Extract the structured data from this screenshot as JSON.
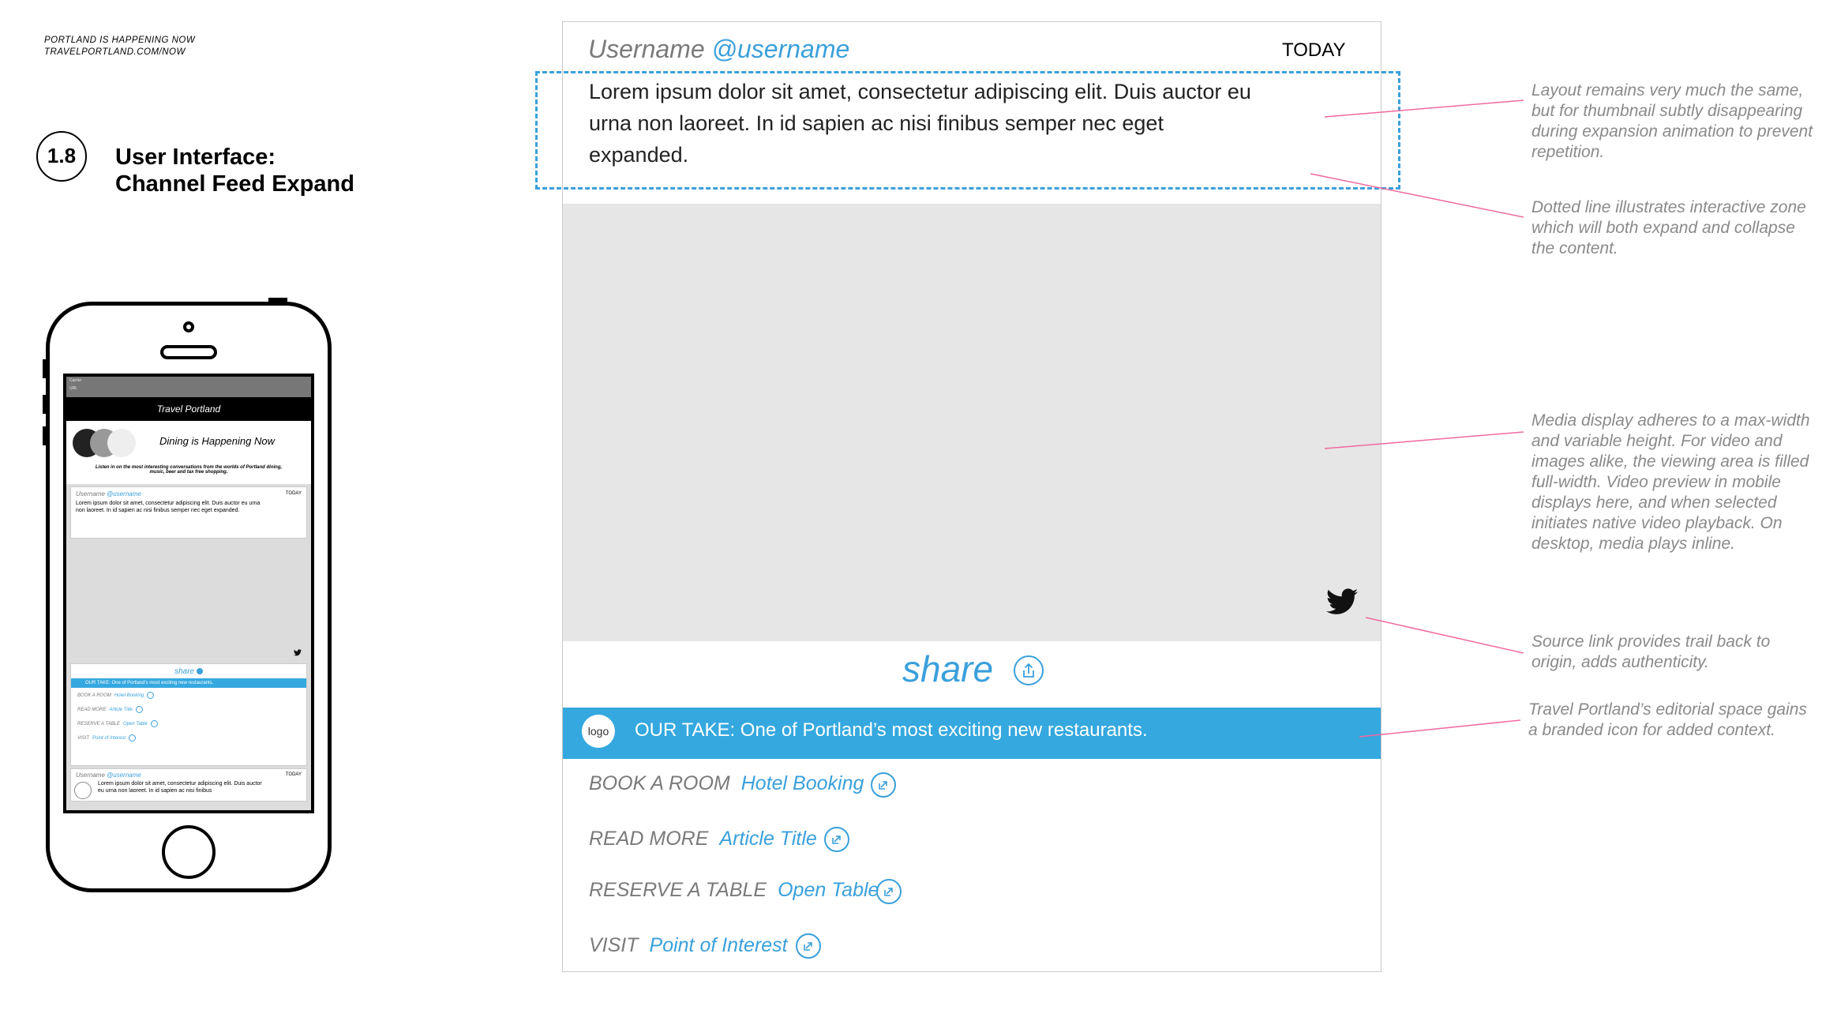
{
  "meta": {
    "line1": "PORTLAND IS HAPPENING NOW",
    "line2": "TRAVELPORTLAND.COM/NOW"
  },
  "section": {
    "number": "1.8",
    "title_line1": "User Interface:",
    "title_line2": "Channel Feed Expand"
  },
  "phone": {
    "status1": "Carrier",
    "status2": "URL",
    "app_title": "Travel Portland",
    "hero_title": "Dining is Happening Now",
    "hero_desc": "Listen in on the most interesting conversations from the worlds of Portland dining, music, beer and tax free shopping.",
    "card_user": "Username",
    "card_handle": "@username",
    "card_date": "TODAY",
    "card_body": "Lorem ipsum dolor sit amet, consectetur adipiscing elit. Duis auctor eu urna non laoreet. In id sapien ac nisi finibus semper nec eget expanded.",
    "share": "share",
    "take": "OUR TAKE: One of Portland's most exciting new restaurants.",
    "links": [
      {
        "label": "BOOK A ROOM",
        "link": "Hotel Booking"
      },
      {
        "label": "READ MORE",
        "link": "Article Title"
      },
      {
        "label": "RESERVE A TABLE",
        "link": "Open Table"
      },
      {
        "label": "VISIT",
        "link": "Point of Interest"
      }
    ],
    "card2_user": "Username",
    "card2_handle": "@username",
    "card2_date": "TODAY",
    "card2_body": "Lorem ipsum dolor sit amet, consectetur adipiscing elit. Duis auctor eu urna non laoreet. In id sapien ac nisi finibus"
  },
  "card": {
    "username": "Username",
    "handle": "@username",
    "date": "TODAY",
    "body": "Lorem ipsum dolor sit amet, consectetur adipiscing elit. Duis auctor eu urna non laoreet. In id sapien ac nisi finibus semper nec eget expanded.",
    "share": "share",
    "logo": "logo",
    "take": "OUR TAKE: One of Portland’s most exciting new restaurants.",
    "links": [
      {
        "label": "BOOK A ROOM",
        "link": "Hotel Booking"
      },
      {
        "label": "READ MORE",
        "link": "Article Title"
      },
      {
        "label": "RESERVE A TABLE",
        "link": "Open Table"
      },
      {
        "label": "VISIT",
        "link": "Point of Interest"
      }
    ]
  },
  "notes": [
    "Layout remains very much the same, but for thumbnail subtly disappearing during expansion animation to prevent repetition.",
    "Dotted line illustrates interactive zone which will both expand and collapse the content.",
    "Media display adheres to a max-width and variable height. For video and images alike, the viewing area is filled full-width. Video preview in mobile displays here, and when selected initiates native video playback. On desktop, media plays inline.",
    "Source link provides trail back to origin, adds authenticity.",
    "Travel Portland’s editorial space gains a branded icon for added context."
  ],
  "colors": {
    "accent": "#35a8df",
    "annotation_line": "#f06aa0",
    "media_bg": "#e6e6e6"
  },
  "icons": [
    "share-icon",
    "twitter-icon",
    "external-link-icon"
  ]
}
